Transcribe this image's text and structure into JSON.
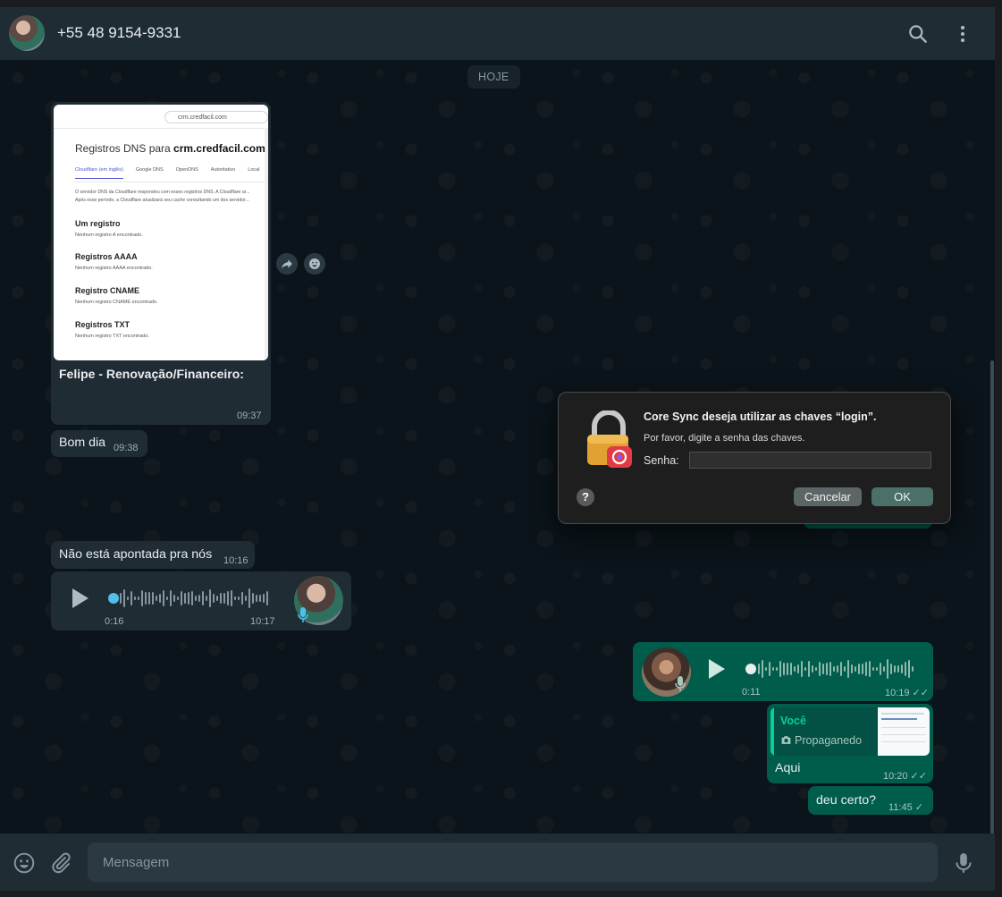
{
  "header": {
    "contact_name": "+55 48 9154-9331",
    "avatar_icon": "contact-avatar",
    "search_icon": "search-icon",
    "menu_icon": "menu-icon"
  },
  "chat": {
    "date_chip": "HOJE",
    "image_message": {
      "screenshot": {
        "search_text": "crm.credfacil.com",
        "heading_prefix": "Registros DNS para ",
        "heading_domain": "crm.credfacil.com",
        "tabs": [
          "Cloudflare (em inglês)",
          "Google DNS",
          "OpenDNS",
          "Autoritativo",
          "Local"
        ],
        "paragraph_line1": "O servidor DNS da Cloudflare respondeu com esses registros DNS. A Cloudflare ar...",
        "paragraph_line2": "Após esse período, a Cloudflare atualizará seu cache consultando um dos servidor...",
        "sections": [
          {
            "title": "Um registro",
            "note": "Nenhum registro A encontrado."
          },
          {
            "title": "Registros AAAA",
            "note": "Nenhum registro AAAA encontrado."
          },
          {
            "title": "Registro CNAME",
            "note": "Nenhum registro CNAME encontrado."
          },
          {
            "title": "Registros TXT",
            "note": "Nenhum registro TXT encontrado."
          }
        ]
      },
      "caption": "Felipe - Renovação/Financeiro:",
      "time": "09:37"
    },
    "messages": [
      {
        "text": "Bom dia",
        "time": "09:38"
      },
      {
        "text": "Não está apontada pra nós",
        "time": "10:16"
      }
    ],
    "incoming_audio": {
      "duration": "0:16",
      "time": "10:17",
      "progress": 0
    },
    "outgoing_audio": {
      "duration": "0:11",
      "time": "10:19",
      "progress": 0,
      "status": "read"
    },
    "reply_message": {
      "quote_author": "Você",
      "quote_text": "Propaganedo",
      "text": "Aqui",
      "time": "10:20",
      "status": "read"
    },
    "last_message": {
      "text": "deu certo?",
      "time": "11:45",
      "status": "sent"
    }
  },
  "dialog": {
    "title": "Core Sync deseja utilizar as chaves “login”.",
    "message": "Por favor, digite a senha das chaves.",
    "password_label": "Senha:",
    "password_value": "",
    "help_label": "?",
    "cancel_label": "Cancelar",
    "ok_label": "OK"
  },
  "footer": {
    "placeholder": "Mensagem",
    "emoji_icon": "emoji-icon",
    "attach_icon": "attach-icon",
    "mic_icon": "mic-icon"
  },
  "colors": {
    "incoming_bubble": "#202c33",
    "outgoing_bubble": "#005c4b",
    "accent": "#06cf9c",
    "background": "#0b141a"
  }
}
